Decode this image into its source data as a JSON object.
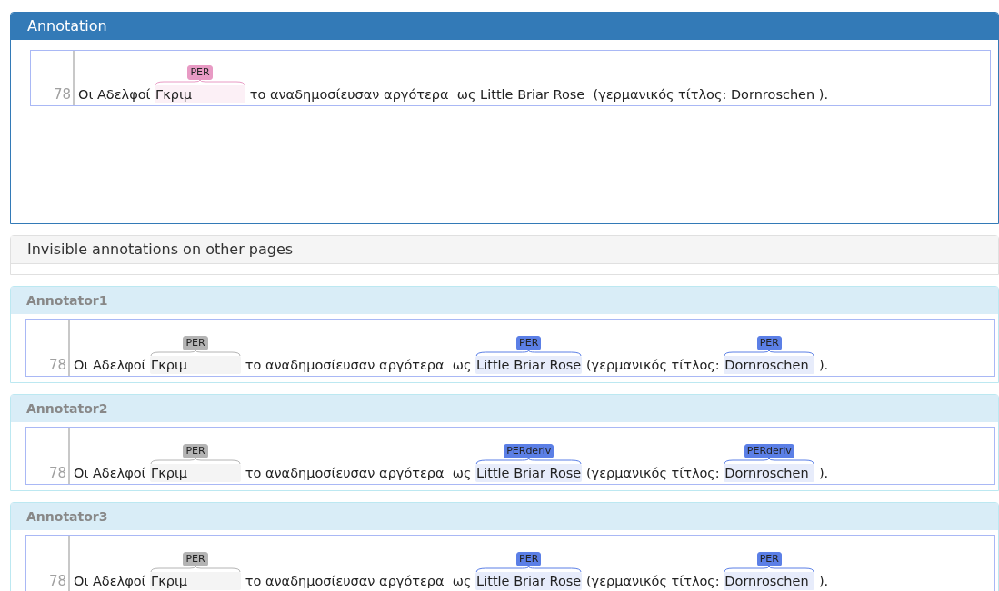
{
  "annotation": {
    "title": "Annotation",
    "line_number": "78",
    "segments": [
      {
        "kind": "plain",
        "text": "Οι Αδελφοί "
      },
      {
        "kind": "entity",
        "text": "Γκριμ",
        "label": "PER",
        "color": "#e89ac4"
      },
      {
        "kind": "plain",
        "text": " το αναδημοσίευσαν αργότερα  ως Little Briar Rose  (γερμανικός τίτλος: Dornroschen )."
      }
    ]
  },
  "invisible_panel": {
    "title": "Invisible annotations on other pages"
  },
  "annotators": [
    {
      "name": "Annotator1",
      "line_number": "78",
      "segments": [
        {
          "kind": "plain",
          "text": "Οι Αδελφοί "
        },
        {
          "kind": "entity",
          "text": "Γκριμ",
          "label": "PER",
          "color": "#b4b4b4"
        },
        {
          "kind": "plain",
          "text": " το αναδημοσίευσαν αργότερα  ως "
        },
        {
          "kind": "entity",
          "text": "Little Briar Rose",
          "label": "PER",
          "color": "#5b7fe6"
        },
        {
          "kind": "plain",
          "text": " (γερμανικός τίτλος: "
        },
        {
          "kind": "entity",
          "text": "Dornroschen",
          "label": "PER",
          "color": "#5b7fe6"
        },
        {
          "kind": "plain",
          "text": " )."
        }
      ]
    },
    {
      "name": "Annotator2",
      "line_number": "78",
      "segments": [
        {
          "kind": "plain",
          "text": "Οι Αδελφοί "
        },
        {
          "kind": "entity",
          "text": "Γκριμ",
          "label": "PER",
          "color": "#b4b4b4"
        },
        {
          "kind": "plain",
          "text": " το αναδημοσίευσαν αργότερα  ως "
        },
        {
          "kind": "entity",
          "text": "Little Briar Rose",
          "label": "PERderiv",
          "color": "#5b7fe6"
        },
        {
          "kind": "plain",
          "text": " (γερμανικός τίτλος: "
        },
        {
          "kind": "entity",
          "text": "Dornroschen",
          "label": "PERderiv",
          "color": "#5b7fe6"
        },
        {
          "kind": "plain",
          "text": " )."
        }
      ]
    },
    {
      "name": "Annotator3",
      "line_number": "78",
      "segments": [
        {
          "kind": "plain",
          "text": "Οι Αδελφοί "
        },
        {
          "kind": "entity",
          "text": "Γκριμ",
          "label": "PER",
          "color": "#b4b4b4"
        },
        {
          "kind": "plain",
          "text": " το αναδημοσίευσαν αργότερα  ως "
        },
        {
          "kind": "entity",
          "text": "Little Briar Rose",
          "label": "PER",
          "color": "#5b7fe6"
        },
        {
          "kind": "plain",
          "text": " (γερμανικός τίτλος: "
        },
        {
          "kind": "entity",
          "text": "Dornroschen",
          "label": "PER",
          "color": "#5b7fe6"
        },
        {
          "kind": "plain",
          "text": " )."
        }
      ]
    }
  ]
}
